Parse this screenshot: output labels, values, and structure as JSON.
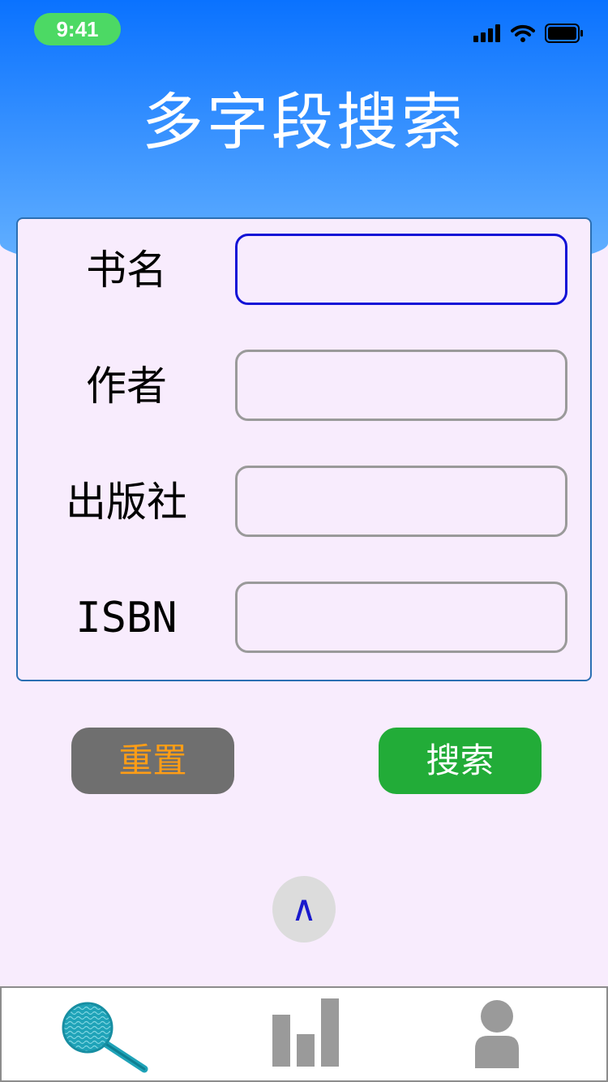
{
  "status_bar": {
    "time": "9:41",
    "icons": [
      "signal-icon",
      "wifi-icon",
      "battery-icon"
    ]
  },
  "header": {
    "title": "多字段搜索"
  },
  "form": {
    "fields": [
      {
        "label": "书名",
        "value": "",
        "focused": true
      },
      {
        "label": "作者",
        "value": ""
      },
      {
        "label": "出版社",
        "value": ""
      },
      {
        "label": "ISBN",
        "value": ""
      }
    ]
  },
  "actions": {
    "reset_label": "重置",
    "search_label": "搜索"
  },
  "scroll_top": {
    "glyph": "∧"
  },
  "tab_bar": {
    "tabs": [
      {
        "icon": "search-magnifier-icon",
        "active": true
      },
      {
        "icon": "bar-chart-icon",
        "active": false
      },
      {
        "icon": "user-profile-icon",
        "active": false
      }
    ]
  },
  "colors": {
    "header_gradient_top": "#0a72ff",
    "header_gradient_bottom": "#67b3ff",
    "page_background": "#f8ecfd",
    "card_border": "#2b6fb3",
    "focused_input_border": "#1212d6",
    "input_border": "#9a9a9a",
    "reset_button_bg": "#6f6f6f",
    "reset_button_text": "#ff9d16",
    "search_button_bg": "#22ac38",
    "time_pill": "#4cd964",
    "active_tab_icon": "#1fa3b8",
    "inactive_tab_icon": "#9a9a9a"
  }
}
